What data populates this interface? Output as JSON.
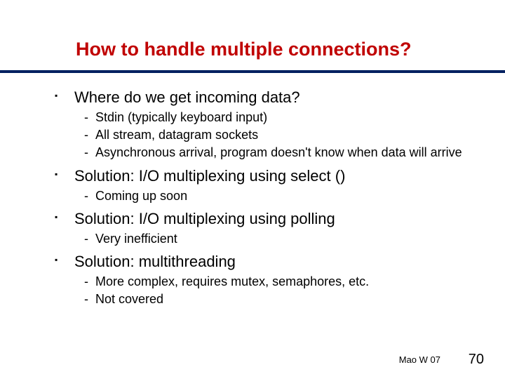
{
  "title": "How to handle multiple connections?",
  "bullets": [
    {
      "text": "Where do we get incoming data?",
      "sub": [
        "Stdin (typically keyboard input)",
        "All stream, datagram sockets",
        "Asynchronous arrival, program doesn't know when data will arrive"
      ]
    },
    {
      "text": "Solution: I/O multiplexing using select ()",
      "sub": [
        "Coming up soon"
      ]
    },
    {
      "text": "Solution: I/O multiplexing using polling",
      "sub": [
        "Very inefficient"
      ]
    },
    {
      "text": "Solution: multithreading",
      "sub": [
        "More complex, requires mutex, semaphores, etc.",
        "Not covered"
      ]
    }
  ],
  "footer": {
    "author": "Mao W 07",
    "page": "70"
  }
}
